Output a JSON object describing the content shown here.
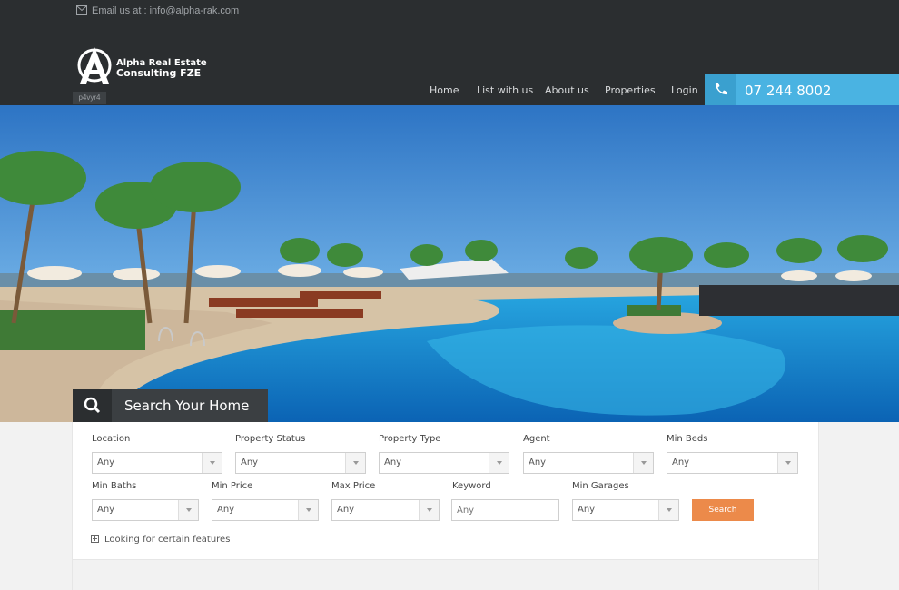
{
  "topbar": {
    "email_label": "Email us at : info@alpha-rak.com"
  },
  "brand": {
    "name_line1": "Alpha Real Estate",
    "name_line2": "Consulting FZE",
    "tag": "p4vyr4"
  },
  "nav": {
    "items": [
      {
        "label": "Home"
      },
      {
        "label": "List with us"
      },
      {
        "label": "About us"
      },
      {
        "label": "Properties"
      },
      {
        "label": "Login"
      }
    ]
  },
  "phone": {
    "number": "07 244 8002",
    "icon": "phone-icon"
  },
  "search": {
    "title": "Search Your Home",
    "fields": {
      "location": {
        "label": "Location",
        "value": "Any"
      },
      "property_status": {
        "label": "Property Status",
        "value": "Any"
      },
      "property_type": {
        "label": "Property Type",
        "value": "Any"
      },
      "agent": {
        "label": "Agent",
        "value": "Any"
      },
      "min_beds": {
        "label": "Min Beds",
        "value": "Any"
      },
      "min_baths": {
        "label": "Min Baths",
        "value": "Any"
      },
      "min_price": {
        "label": "Min Price",
        "value": "Any"
      },
      "max_price": {
        "label": "Max Price",
        "value": "Any"
      },
      "keyword": {
        "label": "Keyword",
        "placeholder": "Any"
      },
      "min_garages": {
        "label": "Min Garages",
        "value": "Any"
      }
    },
    "button": "Search",
    "features_toggle": "Looking for certain features"
  },
  "colors": {
    "header": "#2b2e30",
    "phone_accent": "#4ab3e2",
    "search_button": "#ec8a4a"
  }
}
